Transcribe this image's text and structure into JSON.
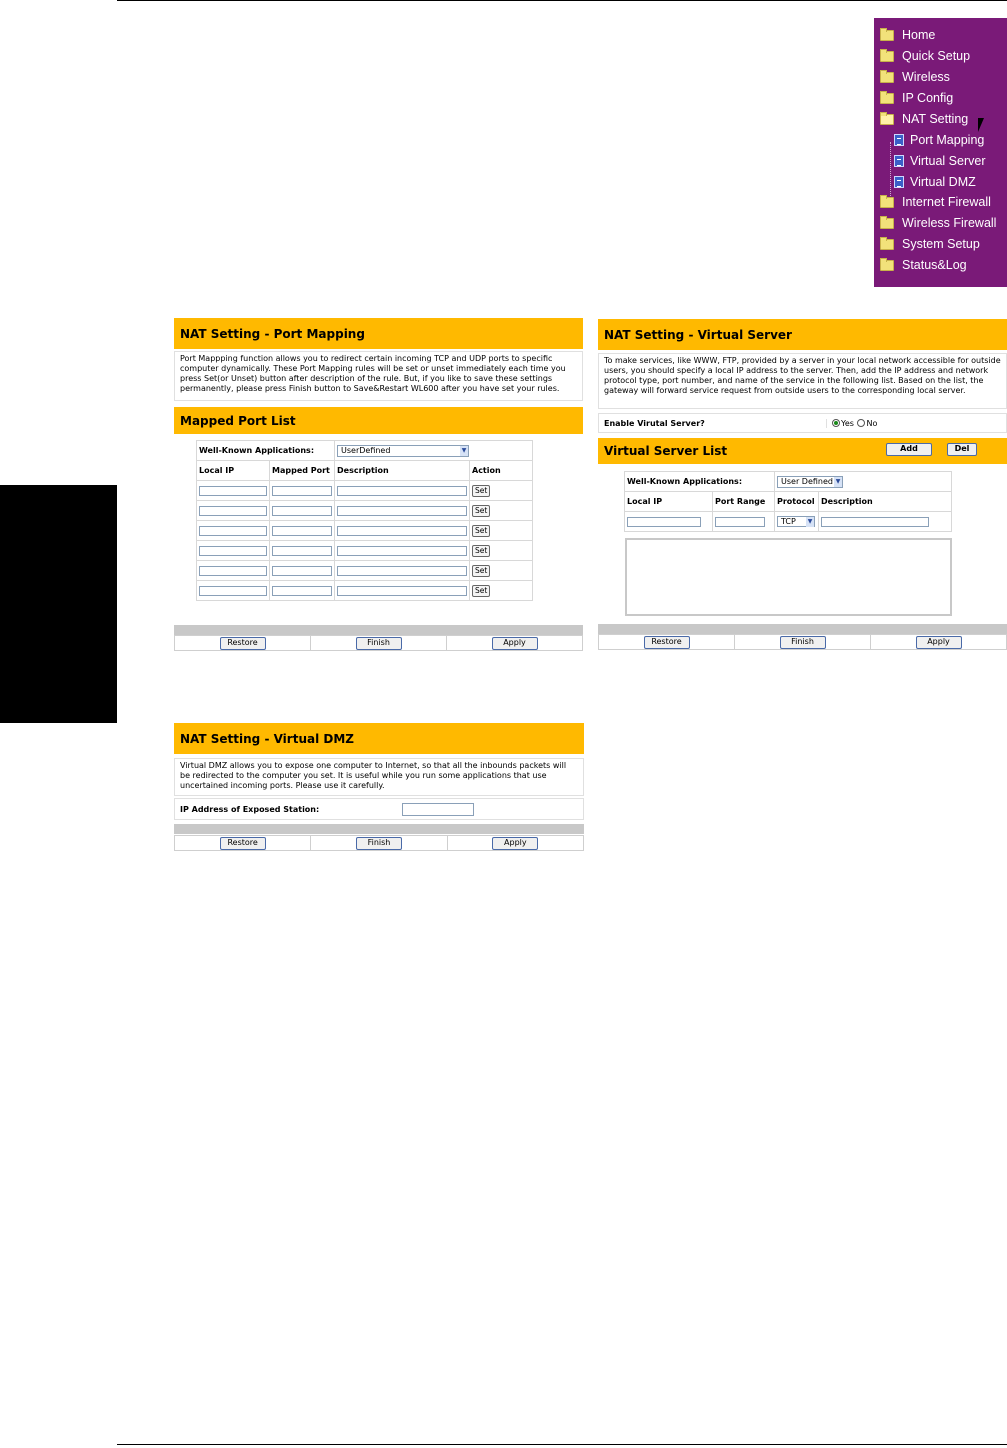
{
  "nav": {
    "items": [
      {
        "label": "Home",
        "icon": "folder-icon"
      },
      {
        "label": "Quick Setup",
        "icon": "folder-icon"
      },
      {
        "label": "Wireless",
        "icon": "folder-icon"
      },
      {
        "label": "IP Config",
        "icon": "folder-icon"
      },
      {
        "label": "NAT Setting",
        "icon": "folder-open-icon"
      },
      {
        "label": "Port Mapping",
        "icon": "document-icon"
      },
      {
        "label": "Virtual Server",
        "icon": "document-icon"
      },
      {
        "label": "Virtual DMZ",
        "icon": "document-icon"
      },
      {
        "label": "Internet Firewall",
        "icon": "folder-icon"
      },
      {
        "label": "Wireless Firewall",
        "icon": "folder-icon"
      },
      {
        "label": "System Setup",
        "icon": "folder-icon"
      },
      {
        "label": "Status&Log",
        "icon": "folder-icon"
      }
    ],
    "bg_color": "#7a1a78"
  },
  "port_mapping": {
    "title": "NAT Setting - Port Mapping",
    "description": "Port Mappping function allows you to redirect certain incoming TCP and UDP ports to specific computer dynamically. These Port Mapping rules will be set or unset immediately each time you press Set(or Unset) button after description of the rule. But, if you like to save these settings permanently, please press Finish button to Save&Restart WL600 after you have set your rules.",
    "list_title": "Mapped Port List",
    "apps_label": "Well-Known Applications:",
    "apps_value": "UserDefined",
    "columns": [
      "Local IP",
      "Mapped Port",
      "Description",
      "Action"
    ],
    "set_label": "Set",
    "buttons": [
      "Restore",
      "Finish",
      "Apply"
    ]
  },
  "virtual_server": {
    "title": "NAT Setting - Virtual Server",
    "description": "To make services, like WWW, FTP, provided by a server in your local network accessible for outside users, you should specify a local IP address to the server. Then, add the IP address and network protocol type, port number, and name of the service in the following list. Based on the list, the gateway will forward service request from outside users to the corresponding local server.",
    "enable_label": "Enable Virutal Server?",
    "yes_label": "Yes",
    "no_label": "No",
    "list_title": "Virtual Server List",
    "add_label": "Add",
    "del_label": "Del",
    "apps_label": "Well-Known Applications:",
    "apps_value": "User Defined",
    "columns": [
      "Local IP",
      "Port Range",
      "Protocol",
      "Description"
    ],
    "protocol_value": "TCP",
    "buttons": [
      "Restore",
      "Finish",
      "Apply"
    ]
  },
  "virtual_dmz": {
    "title": "NAT Setting - Virtual DMZ",
    "description": "Virtual DMZ allows you to expose one computer to Internet, so that all the inbounds packets will be redirected to the computer you set. It is useful while you run some applications that use uncertained incoming ports. Please use it carefully.",
    "ip_label": "IP Address of Exposed Station:",
    "buttons": [
      "Restore",
      "Finish",
      "Apply"
    ]
  },
  "colors": {
    "header": "#ffb900",
    "side_tab": "#000000"
  }
}
